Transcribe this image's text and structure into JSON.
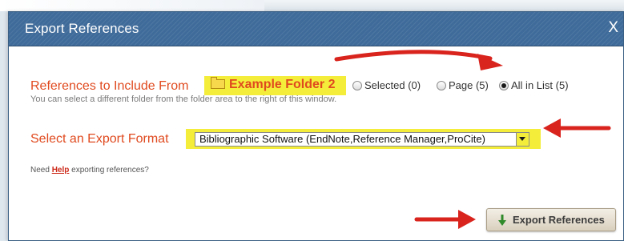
{
  "dialog": {
    "title": "Export References",
    "close_glyph": "X"
  },
  "references_row": {
    "label": "References to Include From",
    "folder_name": "Example Folder 2",
    "folder_icon": "folder-icon",
    "options": [
      {
        "label": "Selected (0)",
        "checked": false
      },
      {
        "label": "Page (5)",
        "checked": false
      },
      {
        "label": "All in List (5)",
        "checked": true
      }
    ],
    "hint": "You can select a different folder from the folder area to the right of this window."
  },
  "format_row": {
    "label": "Select an Export Format",
    "selected_value": "Bibliographic Software (EndNote,Reference Manager,ProCite)"
  },
  "help_line": {
    "before": "Need ",
    "link": "Help",
    "after": " exporting references?"
  },
  "export_button": {
    "label": "Export References",
    "icon": "down-arrow-icon"
  },
  "colors": {
    "titlebar": "#3f6b9a",
    "label_orange": "#e04a1f",
    "highlight_yellow": "#f4ee3a",
    "annotation_red": "#d9231d"
  }
}
